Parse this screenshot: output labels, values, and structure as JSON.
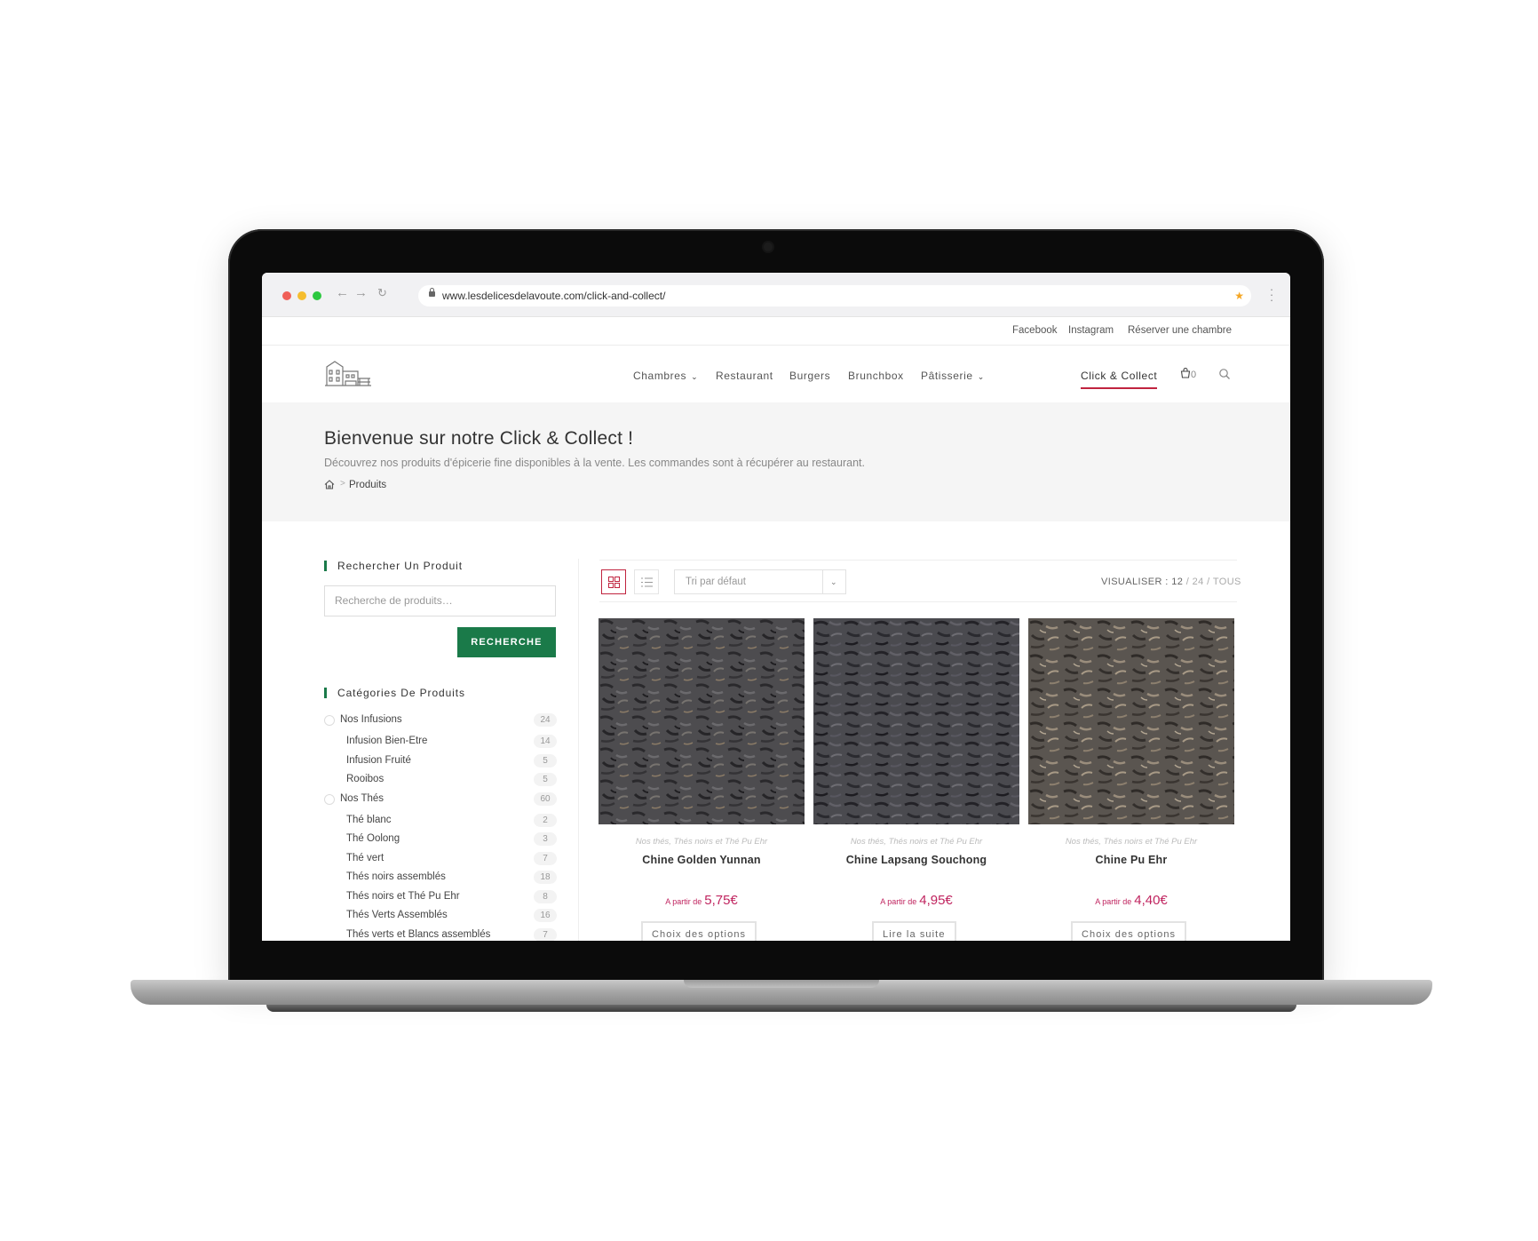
{
  "browser": {
    "url": "www.lesdelicesdelavoute.com/click-and-collect/"
  },
  "topbar": {
    "links": [
      "Facebook",
      "Instagram",
      "Réserver une chambre"
    ]
  },
  "nav": {
    "items": [
      "Chambres",
      "Restaurant",
      "Burgers",
      "Brunchbox",
      "Pâtisserie",
      "Click & Collect"
    ],
    "cart_count": "0",
    "accent_color": "#c0243f"
  },
  "page": {
    "title": "Bienvenue sur notre Click & Collect !",
    "subtitle": "Découvrez nos produits d'épicerie fine disponibles à la vente. Les commandes sont à récupérer au restaurant.",
    "breadcrumb_sep": ">",
    "breadcrumb_current": "Produits"
  },
  "sidebar": {
    "search_title": "Rechercher Un Produit",
    "search_placeholder": "Recherche de produits…",
    "search_button": "RECHERCHE",
    "categories_title": "Catégories De Produits",
    "categories": [
      {
        "label": "Nos Infusions",
        "count": "24",
        "level": "parent"
      },
      {
        "label": "Infusion Bien-Etre",
        "count": "14",
        "level": "child"
      },
      {
        "label": "Infusion Fruité",
        "count": "5",
        "level": "child"
      },
      {
        "label": "Rooibos",
        "count": "5",
        "level": "child"
      },
      {
        "label": "Nos Thés",
        "count": "60",
        "level": "parent"
      },
      {
        "label": "Thé blanc",
        "count": "2",
        "level": "child"
      },
      {
        "label": "Thé Oolong",
        "count": "3",
        "level": "child"
      },
      {
        "label": "Thé vert",
        "count": "7",
        "level": "child"
      },
      {
        "label": "Thés noirs assemblés",
        "count": "18",
        "level": "child"
      },
      {
        "label": "Thés noirs et Thé Pu Ehr",
        "count": "8",
        "level": "child"
      },
      {
        "label": "Thés Verts Assemblés",
        "count": "16",
        "level": "child"
      },
      {
        "label": "Thés verts et Blancs assemblés",
        "count": "7",
        "level": "child"
      }
    ],
    "accent_color": "#1a7a49"
  },
  "toolbar": {
    "sort_label": "Tri par défaut",
    "visualiser_label": "VISUALISER :",
    "visualiser_current": "12",
    "visualiser_rest": "/ 24 / TOUS"
  },
  "products": [
    {
      "category": "Nos thés, Thés noirs et Thé Pu Ehr",
      "name": "Chine Golden Yunnan",
      "price_prefix": "A partir de",
      "price": "5,75€",
      "button": "Choix des options"
    },
    {
      "category": "Nos thés, Thés noirs et Thé Pu Ehr",
      "name": "Chine Lapsang Souchong",
      "price_prefix": "A partir de",
      "price": "4,95€",
      "button": "Lire la suite"
    },
    {
      "category": "Nos thés, Thés noirs et Thé Pu Ehr",
      "name": "Chine Pu Ehr",
      "price_prefix": "A partir de",
      "price": "4,40€",
      "button": "Choix des options"
    }
  ]
}
